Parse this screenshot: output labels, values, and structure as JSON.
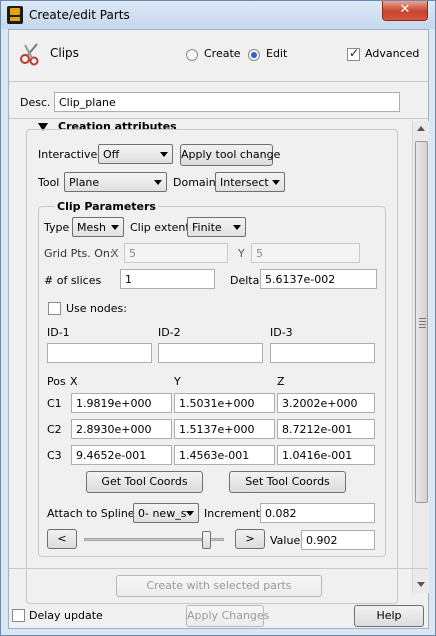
{
  "window": {
    "title": "Create/edit Parts",
    "close_glyph": "✕"
  },
  "header": {
    "part_type": "Clips",
    "icon": "scissors-icon",
    "mode_create": "Create",
    "mode_edit": "Edit",
    "mode_selected": "Edit",
    "advanced_label": "Advanced",
    "advanced_checked": true
  },
  "desc": {
    "label": "Desc.",
    "value": "Clip_plane"
  },
  "creation": {
    "title": "Creation attributes",
    "interactive_label": "Interactive",
    "interactive_value": "Off",
    "apply_tool_change": "Apply tool change",
    "tool_label": "Tool",
    "tool_value": "Plane",
    "domain_label": "Domain",
    "domain_value": "Intersect"
  },
  "clip": {
    "title": "Clip Parameters",
    "type_label": "Type",
    "type_value": "Mesh",
    "extent_label": "Clip extent",
    "extent_value": "Finite",
    "grid_label": "Grid Pts. On:",
    "grid_x_label": "X",
    "grid_x_value": "5",
    "grid_y_label": "Y",
    "grid_y_value": "5",
    "slices_label": "# of slices",
    "slices_value": "1",
    "delta_label": "Delta",
    "delta_value": "5.6137e-002",
    "use_nodes_label": "Use nodes:",
    "use_nodes_checked": false,
    "id1_label": "ID-1",
    "id1_value": "",
    "id2_label": "ID-2",
    "id2_value": "",
    "id3_label": "ID-3",
    "id3_value": "",
    "pos_label": "Pos",
    "col_x": "X",
    "col_y": "Y",
    "col_z": "Z",
    "rows": [
      {
        "label": "C1",
        "x": "1.9819e+000",
        "y": "1.5031e+000",
        "z": "3.2002e+000"
      },
      {
        "label": "C2",
        "x": "2.8930e+000",
        "y": "1.5137e+000",
        "z": "8.7212e-001"
      },
      {
        "label": "C3",
        "x": "9.4652e-001",
        "y": "1.4563e-001",
        "z": "1.0416e-001"
      }
    ],
    "get_tool_coords": "Get Tool Coords",
    "set_tool_coords": "Set Tool Coords",
    "attach_label": "Attach to Spline",
    "attach_value": "0- new_s",
    "increment_label": "Increment",
    "increment_value": "0.082",
    "prev_label": "<",
    "next_label": ">",
    "value_label": "Value",
    "value_value": "0.902",
    "slider_fraction": 0.9
  },
  "footer": {
    "create_button": "Create with selected parts",
    "delay_update_label": "Delay update",
    "delay_update_checked": false,
    "apply_changes": "Apply Changes",
    "help": "Help"
  }
}
